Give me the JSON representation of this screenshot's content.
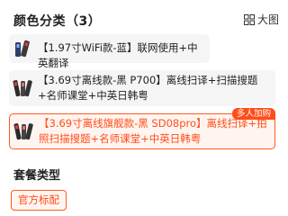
{
  "section_title": "颜色分类（3）",
  "big_view_label": "大图",
  "options": [
    {
      "label": "【1.97寸WiFi款-蓝】联网使用+中英翻译",
      "selected": false
    },
    {
      "label": "【3.69寸离线款-黑 P700】离线扫译+扫描搜题+名师课堂+中英日韩粤",
      "selected": false
    },
    {
      "label": "【3.69寸离线旗舰款-黑 SD08pro】离线扫译+拍照扫描搜题+名师课堂+中英日韩粤",
      "selected": true,
      "badge": "多人加购"
    }
  ],
  "package_title": "套餐类型",
  "package_option": "官方标配",
  "colors": {
    "accent": "#ff4d1a",
    "option_bg": "#f5f5f5",
    "selected_bg": "#fff5f0"
  }
}
